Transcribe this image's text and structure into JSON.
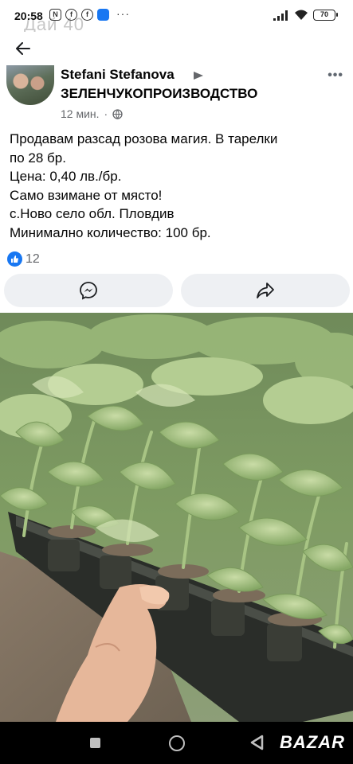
{
  "status_bar": {
    "time": "20:58",
    "ghost_text": "Дай 40",
    "battery": "70",
    "dots": "···"
  },
  "post": {
    "author": "Stefani Stefanova",
    "group": "ЗЕЛЕНЧУКОПРОИЗВОДСТВО",
    "time": "12 мин.",
    "more": "•••",
    "body_lines": [
      "Продавам разсад розова магия. В тарелки",
      "по 28 бр.",
      "Цена: 0,40 лв./бр.",
      "Само взимане от място!",
      "с.Ново село обл. Пловдив",
      "Минимално количество: 100 бр."
    ],
    "reaction_count": "12"
  },
  "icons": {
    "back": "arrow-left-icon",
    "messenger": "messenger-icon",
    "share": "share-icon",
    "globe": "globe-icon",
    "like": "like-icon"
  },
  "watermark": "BAZAR",
  "colors": {
    "accent": "#1877f2",
    "button_bg": "#eef0f3",
    "secondary_text": "#65676b"
  }
}
